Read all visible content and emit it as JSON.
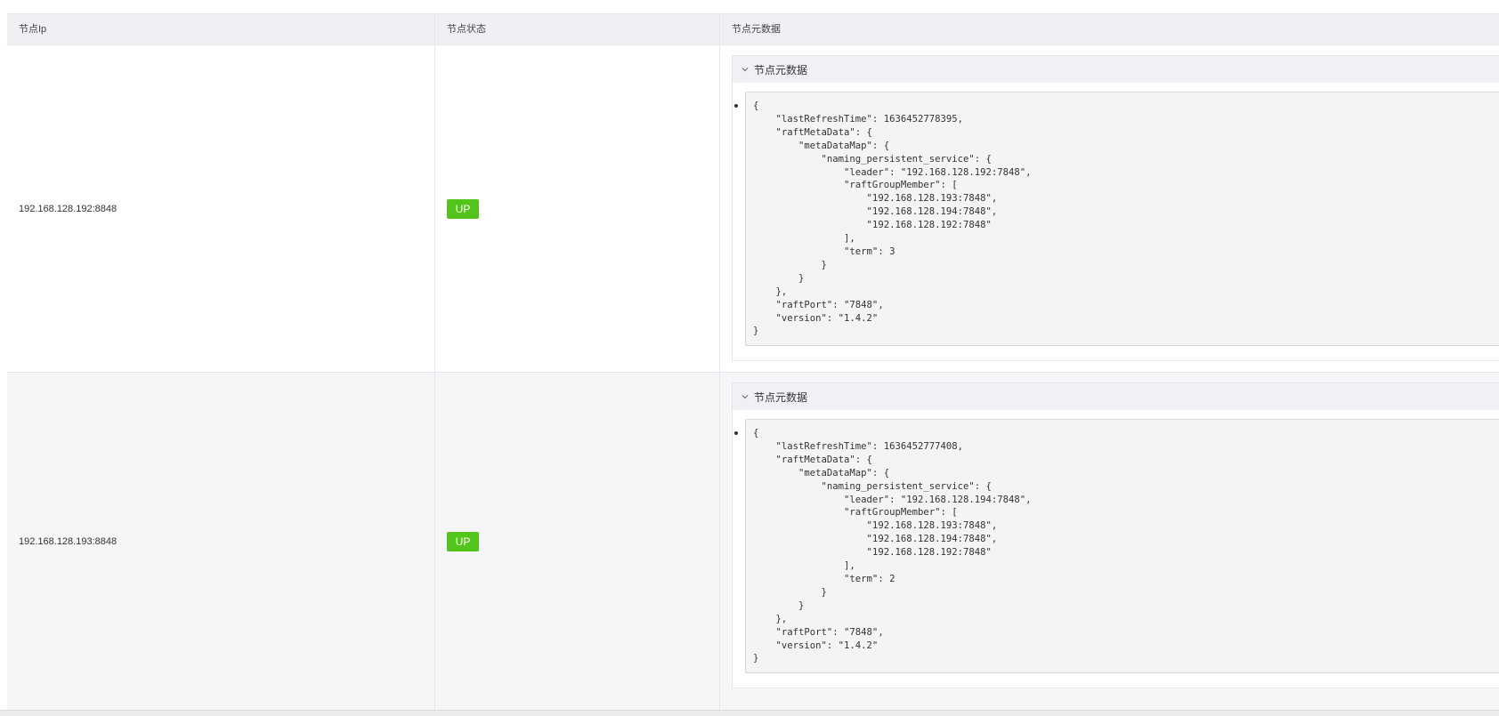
{
  "table": {
    "headers": [
      "节点Ip",
      "节点状态",
      "节点元数据"
    ],
    "rows": [
      {
        "ip": "192.168.128.192:8848",
        "status": "UP",
        "meta_title": "节点元数据",
        "meta_json": "{\n    \"lastRefreshTime\": 1636452778395,\n    \"raftMetaData\": {\n        \"metaDataMap\": {\n            \"naming_persistent_service\": {\n                \"leader\": \"192.168.128.192:7848\",\n                \"raftGroupMember\": [\n                    \"192.168.128.193:7848\",\n                    \"192.168.128.194:7848\",\n                    \"192.168.128.192:7848\"\n                ],\n                \"term\": 3\n            }\n        }\n    },\n    \"raftPort\": \"7848\",\n    \"version\": \"1.4.2\"\n}"
      },
      {
        "ip": "192.168.128.193:8848",
        "status": "UP",
        "meta_title": "节点元数据",
        "meta_json": "{\n    \"lastRefreshTime\": 1636452777408,\n    \"raftMetaData\": {\n        \"metaDataMap\": {\n            \"naming_persistent_service\": {\n                \"leader\": \"192.168.128.194:7848\",\n                \"raftGroupMember\": [\n                    \"192.168.128.193:7848\",\n                    \"192.168.128.194:7848\",\n                    \"192.168.128.192:7848\"\n                ],\n                \"term\": 2\n            }\n        }\n    },\n    \"raftPort\": \"7848\",\n    \"version\": \"1.4.2\"\n}"
      }
    ]
  },
  "colors": {
    "status_up": "#52c41a",
    "header_bg": "#eef0f3",
    "stripe_bg": "#f5f6f8"
  }
}
